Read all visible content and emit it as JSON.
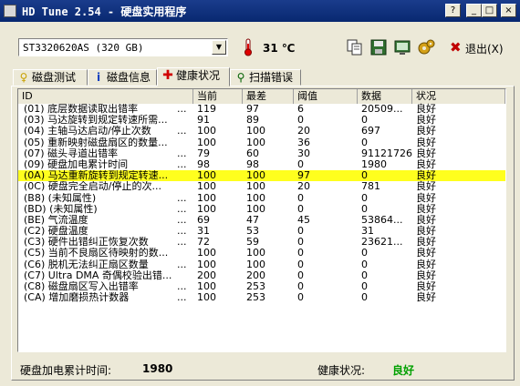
{
  "window": {
    "title": "HD Tune 2.54 - 硬盘实用程序",
    "help_btn": "?",
    "minimize_btn": "_",
    "maximize_btn": "□",
    "close_btn": "×"
  },
  "toolbar": {
    "drive": "ST3320620AS (320 GB)",
    "temperature": "31 ℃",
    "exit_label": "退出(X)"
  },
  "tabs": [
    {
      "label": "磁盘测试",
      "icon": "lightbulb-icon"
    },
    {
      "label": "磁盘信息",
      "icon": "info-icon"
    },
    {
      "label": "健康状况",
      "icon": "plus-icon",
      "active": true
    },
    {
      "label": "扫描错误",
      "icon": "magnifier-icon"
    }
  ],
  "table": {
    "columns": [
      "ID",
      "当前",
      "最差",
      "阈值",
      "数据",
      "状况"
    ],
    "rows": [
      {
        "id": "(01) 底层数据读取出错率",
        "dots": "...",
        "current": "119",
        "worst": "97",
        "threshold": "6",
        "data": "20509...",
        "status": "良好"
      },
      {
        "id": "(03) 马达旋转到规定转速所需...",
        "dots": "",
        "current": "91",
        "worst": "89",
        "threshold": "0",
        "data": "0",
        "status": "良好"
      },
      {
        "id": "(04) 主轴马达启动/停止次数",
        "dots": "...",
        "current": "100",
        "worst": "100",
        "threshold": "20",
        "data": "697",
        "status": "良好"
      },
      {
        "id": "(05) 重新映射磁盘扇区的数量...",
        "dots": "",
        "current": "100",
        "worst": "100",
        "threshold": "36",
        "data": "0",
        "status": "良好"
      },
      {
        "id": "(07) 磁头寻道出错率",
        "dots": "...",
        "current": "79",
        "worst": "60",
        "threshold": "30",
        "data": "91121726",
        "status": "良好"
      },
      {
        "id": "(09) 硬盘加电累计时间",
        "dots": "...",
        "current": "98",
        "worst": "98",
        "threshold": "0",
        "data": "1980",
        "status": "良好"
      },
      {
        "id": "(0A) 马达重新旋转到规定转速...",
        "dots": "",
        "current": "100",
        "worst": "100",
        "threshold": "97",
        "data": "0",
        "status": "良好",
        "highlight": true
      },
      {
        "id": "(0C) 硬盘完全启动/停止的次...",
        "dots": "",
        "current": "100",
        "worst": "100",
        "threshold": "20",
        "data": "781",
        "status": "良好"
      },
      {
        "id": "(B8) (未知属性)",
        "dots": "...",
        "current": "100",
        "worst": "100",
        "threshold": "0",
        "data": "0",
        "status": "良好"
      },
      {
        "id": "(BD) (未知属性)",
        "dots": "...",
        "current": "100",
        "worst": "100",
        "threshold": "0",
        "data": "0",
        "status": "良好"
      },
      {
        "id": "(BE) 气流温度",
        "dots": "...",
        "current": "69",
        "worst": "47",
        "threshold": "45",
        "data": "53864...",
        "status": "良好"
      },
      {
        "id": "(C2) 硬盘温度",
        "dots": "...",
        "current": "31",
        "worst": "53",
        "threshold": "0",
        "data": "31",
        "status": "良好"
      },
      {
        "id": "(C3) 硬件出错纠正恢复次数",
        "dots": "...",
        "current": "72",
        "worst": "59",
        "threshold": "0",
        "data": "23621...",
        "status": "良好"
      },
      {
        "id": "(C5) 当前不良扇区待映射的数...",
        "dots": "",
        "current": "100",
        "worst": "100",
        "threshold": "0",
        "data": "0",
        "status": "良好"
      },
      {
        "id": "(C6) 脱机无法纠正扇区数量",
        "dots": "...",
        "current": "100",
        "worst": "100",
        "threshold": "0",
        "data": "0",
        "status": "良好"
      },
      {
        "id": "(C7) Ultra DMA 奇偶校验出错...",
        "dots": "",
        "current": "200",
        "worst": "200",
        "threshold": "0",
        "data": "0",
        "status": "良好"
      },
      {
        "id": "(C8) 磁盘扇区写入出错率",
        "dots": "...",
        "current": "100",
        "worst": "253",
        "threshold": "0",
        "data": "0",
        "status": "良好"
      },
      {
        "id": "(CA) 增加磨损热计数器",
        "dots": "...",
        "current": "100",
        "worst": "253",
        "threshold": "0",
        "data": "0",
        "status": "良好"
      }
    ]
  },
  "footer": {
    "power_on_label": "硬盘加电累计时间:",
    "power_on_value": "1980",
    "health_label": "健康状况:",
    "health_value": "良好"
  },
  "colors": {
    "highlight_row": "#ffff1e",
    "health_good": "#00a000",
    "title_bar": "#0a246a"
  }
}
